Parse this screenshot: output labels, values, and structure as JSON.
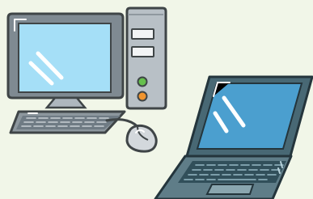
{
  "colors": {
    "background": "#f1f6e8",
    "outline": "#3f4547",
    "monitor_body": "#7f8a92",
    "monitor_screen": "#a5dff7",
    "tower_body": "#b8c0c6",
    "tower_slot": "#f2f4f5",
    "green_led": "#66c04d",
    "orange_led": "#f0942d",
    "laptop_body": "#486874",
    "laptop_screen": "#4b9fcf",
    "laptop_keys": "#314f5a",
    "mouse_body": "#d3d8dc"
  },
  "illustration": {
    "subjects": [
      "desktop-computer",
      "laptop-computer"
    ]
  }
}
